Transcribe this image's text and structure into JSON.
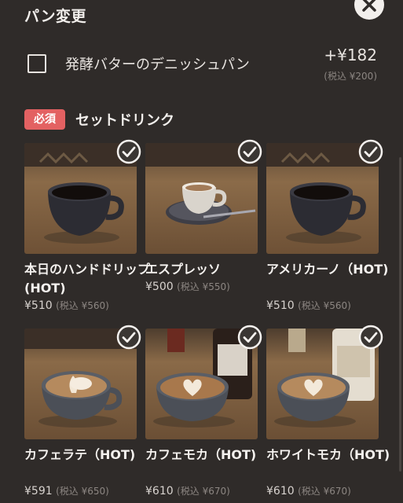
{
  "header": {
    "title": "パン変更"
  },
  "option": {
    "label": "発酵バターのデニッシュパン",
    "price": "+¥182",
    "tax_note": "(税込 ¥200)",
    "checked": false
  },
  "drinks_section": {
    "badge": "必須",
    "title": "セットドリンク"
  },
  "drinks": [
    {
      "name": "本日のハンドドリップ(HOT)",
      "price": "¥510",
      "tax": "(税込 ¥560)",
      "selected": true
    },
    {
      "name": "エスプレッソ",
      "price": "¥500",
      "tax": "(税込 ¥550)",
      "selected": true
    },
    {
      "name": "アメリカーノ（HOT)",
      "price": "¥510",
      "tax": "(税込 ¥560)",
      "selected": true
    },
    {
      "name": "カフェラテ（HOT)",
      "price": "¥591",
      "tax": "(税込 ¥650)",
      "selected": true
    },
    {
      "name": "カフェモカ（HOT)",
      "price": "¥610",
      "tax": "(税込 ¥670)",
      "selected": true
    },
    {
      "name": "ホワイトモカ（HOT)",
      "price": "¥610",
      "tax": "(税込 ¥670)",
      "selected": true
    }
  ],
  "colors": {
    "background": "#2f2b29",
    "badge": "#e36162",
    "text": "#f2efec",
    "muted": "#8c8682"
  }
}
